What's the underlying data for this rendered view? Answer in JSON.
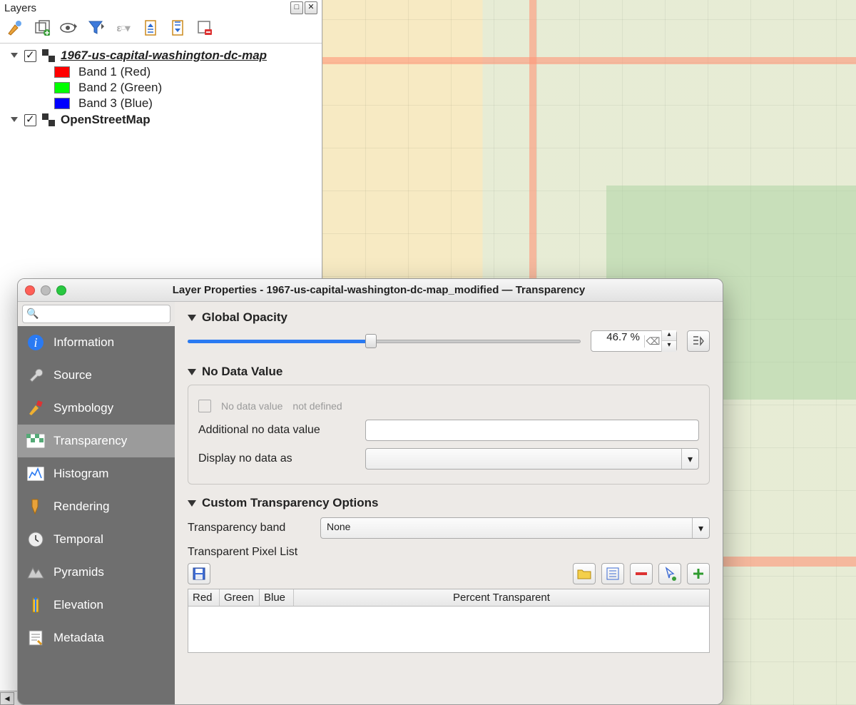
{
  "layers_panel": {
    "title": "Layers"
  },
  "tree": {
    "layer1": {
      "name": "1967-us-capital-washington-dc-map",
      "bands": [
        {
          "label": "Band 1 (Red)",
          "color": "#ff0000"
        },
        {
          "label": "Band 2 (Green)",
          "color": "#00ff00"
        },
        {
          "label": "Band 3 (Blue)",
          "color": "#0000ff"
        }
      ]
    },
    "layer2": {
      "name": "OpenStreetMap"
    }
  },
  "dialog": {
    "title": "Layer Properties - 1967-us-capital-washington-dc-map_modified — Transparency",
    "sidebar": {
      "items": [
        {
          "label": "Information"
        },
        {
          "label": "Source"
        },
        {
          "label": "Symbology"
        },
        {
          "label": "Transparency"
        },
        {
          "label": "Histogram"
        },
        {
          "label": "Rendering"
        },
        {
          "label": "Temporal"
        },
        {
          "label": "Pyramids"
        },
        {
          "label": "Elevation"
        },
        {
          "label": "Metadata"
        }
      ],
      "active_index": 3
    },
    "global_opacity": {
      "heading": "Global Opacity",
      "percent_text": "46.7 %",
      "percent_value": 46.7
    },
    "no_data": {
      "heading": "No Data Value",
      "checkbox_label": "No data value",
      "status": "not defined",
      "additional_label": "Additional no data value",
      "display_as_label": "Display no data as"
    },
    "custom": {
      "heading": "Custom Transparency Options",
      "band_label": "Transparency band",
      "band_value": "None",
      "pixel_list_label": "Transparent Pixel List",
      "columns": {
        "red": "Red",
        "green": "Green",
        "blue": "Blue",
        "pct": "Percent Transparent"
      }
    }
  }
}
